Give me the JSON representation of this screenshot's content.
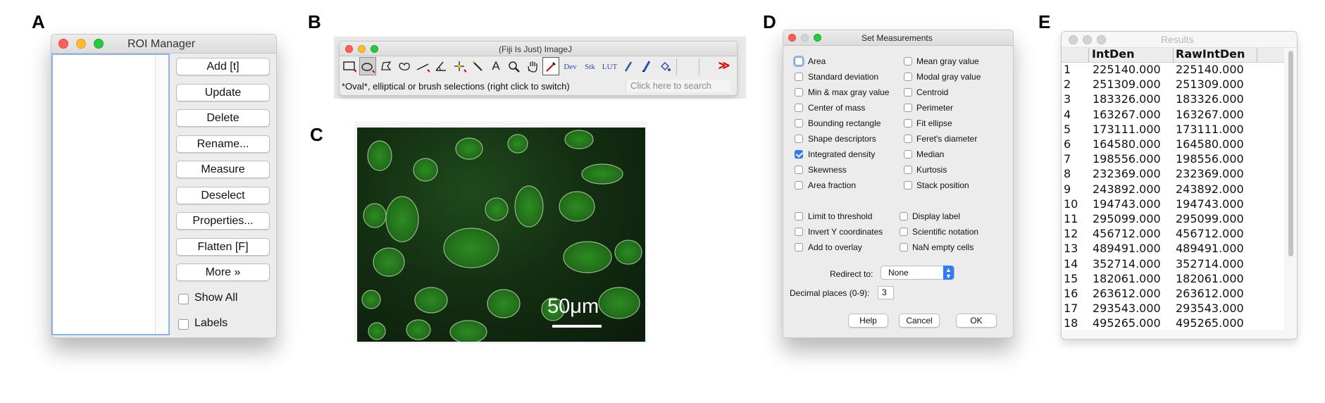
{
  "panel_letters": {
    "a": "A",
    "b": "B",
    "c": "C",
    "d": "D",
    "e": "E"
  },
  "roi_manager": {
    "title": "ROI Manager",
    "buttons": [
      "Add [t]",
      "Update",
      "Delete",
      "Rename...",
      "Measure",
      "Deselect",
      "Properties...",
      "Flatten [F]",
      "More »"
    ],
    "checkboxes": [
      {
        "label": "Show All",
        "checked": false
      },
      {
        "label": "Labels",
        "checked": false
      }
    ]
  },
  "imagej_toolbar": {
    "title": "(Fiji Is Just) ImageJ",
    "status": "*Oval*, elliptical or brush selections (right click to switch)",
    "search_placeholder": "Click here to search",
    "tools": [
      {
        "name": "rectangle-tool-icon"
      },
      {
        "name": "oval-tool-icon",
        "selected": true
      },
      {
        "name": "polygon-tool-icon"
      },
      {
        "name": "freehand-tool-icon"
      },
      {
        "name": "line-tool-icon"
      },
      {
        "name": "angle-tool-icon"
      },
      {
        "name": "point-tool-icon"
      },
      {
        "name": "wand-tool-icon"
      },
      {
        "name": "text-tool-icon",
        "text": "A"
      },
      {
        "name": "magnifier-tool-icon"
      },
      {
        "name": "hand-tool-icon"
      },
      {
        "name": "color-picker-tool-icon"
      },
      {
        "name": "dev-menu",
        "text": "Dev"
      },
      {
        "name": "stk-menu",
        "text": "Stk"
      },
      {
        "name": "lut-menu",
        "text": "LUT"
      },
      {
        "name": "pencil-tool-icon"
      },
      {
        "name": "brush-tool-icon"
      },
      {
        "name": "flood-fill-tool-icon"
      },
      {
        "name": "more-tools-icon",
        "text": "≫"
      }
    ]
  },
  "micrograph": {
    "scale_label": "50μm"
  },
  "set_measurements": {
    "title": "Set Measurements",
    "left_column": [
      {
        "label": "Area",
        "checked": false,
        "focus": true
      },
      {
        "label": "Standard deviation",
        "checked": false
      },
      {
        "label": "Min & max gray value",
        "checked": false
      },
      {
        "label": "Center of mass",
        "checked": false
      },
      {
        "label": "Bounding rectangle",
        "checked": false
      },
      {
        "label": "Shape descriptors",
        "checked": false
      },
      {
        "label": "Integrated density",
        "checked": true
      },
      {
        "label": "Skewness",
        "checked": false
      },
      {
        "label": "Area fraction",
        "checked": false
      }
    ],
    "right_column": [
      {
        "label": "Mean gray value",
        "checked": false
      },
      {
        "label": "Modal gray value",
        "checked": false
      },
      {
        "label": "Centroid",
        "checked": false
      },
      {
        "label": "Perimeter",
        "checked": false
      },
      {
        "label": "Fit ellipse",
        "checked": false
      },
      {
        "label": "Feret's diameter",
        "checked": false
      },
      {
        "label": "Median",
        "checked": false
      },
      {
        "label": "Kurtosis",
        "checked": false
      },
      {
        "label": "Stack position",
        "checked": false
      }
    ],
    "options_left": [
      {
        "label": "Limit to threshold",
        "checked": false
      },
      {
        "label": "Invert Y coordinates",
        "checked": false
      },
      {
        "label": "Add to overlay",
        "checked": false
      }
    ],
    "options_right": [
      {
        "label": "Display label",
        "checked": false
      },
      {
        "label": "Scientific notation",
        "checked": false
      },
      {
        "label": "NaN empty cells",
        "checked": false
      }
    ],
    "redirect_label": "Redirect to:",
    "redirect_value": "None",
    "decimal_label": "Decimal places (0-9):",
    "decimal_value": "3",
    "buttons": {
      "help": "Help",
      "cancel": "Cancel",
      "ok": "OK"
    }
  },
  "results": {
    "title": "Results",
    "columns": [
      "IntDen",
      "RawIntDen"
    ],
    "rows": [
      [
        "1",
        "225140.000",
        "225140.000"
      ],
      [
        "2",
        "251309.000",
        "251309.000"
      ],
      [
        "3",
        "183326.000",
        "183326.000"
      ],
      [
        "4",
        "163267.000",
        "163267.000"
      ],
      [
        "5",
        "173111.000",
        "173111.000"
      ],
      [
        "6",
        "164580.000",
        "164580.000"
      ],
      [
        "7",
        "198556.000",
        "198556.000"
      ],
      [
        "8",
        "232369.000",
        "232369.000"
      ],
      [
        "9",
        "243892.000",
        "243892.000"
      ],
      [
        "10",
        "194743.000",
        "194743.000"
      ],
      [
        "11",
        "295099.000",
        "295099.000"
      ],
      [
        "12",
        "456712.000",
        "456712.000"
      ],
      [
        "13",
        "489491.000",
        "489491.000"
      ],
      [
        "14",
        "352714.000",
        "352714.000"
      ],
      [
        "15",
        "182061.000",
        "182061.000"
      ],
      [
        "16",
        "263612.000",
        "263612.000"
      ],
      [
        "17",
        "293543.000",
        "293543.000"
      ],
      [
        "18",
        "495265.000",
        "495265.000"
      ]
    ]
  }
}
